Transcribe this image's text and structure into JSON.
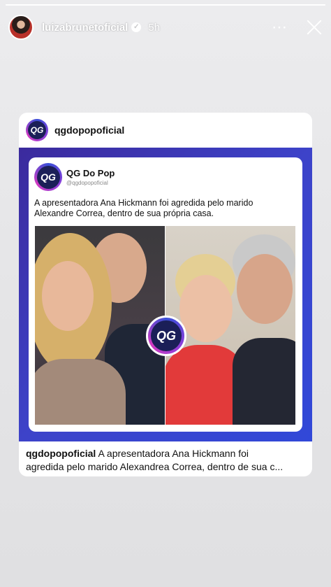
{
  "story": {
    "username": "luizabrunetoficial",
    "timestamp": "5h",
    "progress": 1.0,
    "verified_symbol": "✓",
    "more_icon": "⋯"
  },
  "post": {
    "author": "qgdopopoficial",
    "logo_text": "QG",
    "tweet": {
      "name": "QG Do Pop",
      "handle": "@qgdopopoficial",
      "text": "A apresentadora Ana Hickmann foi agredida pelo marido Alexandre Correa, dentro de sua própria casa."
    },
    "caption": {
      "username": "qgdopopoficial",
      "line1": "A apresentadora Ana Hickmann foi",
      "line2": "agredida pelo marido Alexandrea Correa, dentro de sua c..."
    }
  },
  "colors": {
    "frame_start": "#3b2a9d",
    "frame_end": "#3148d8",
    "logo_inner": "#1b1f58"
  }
}
